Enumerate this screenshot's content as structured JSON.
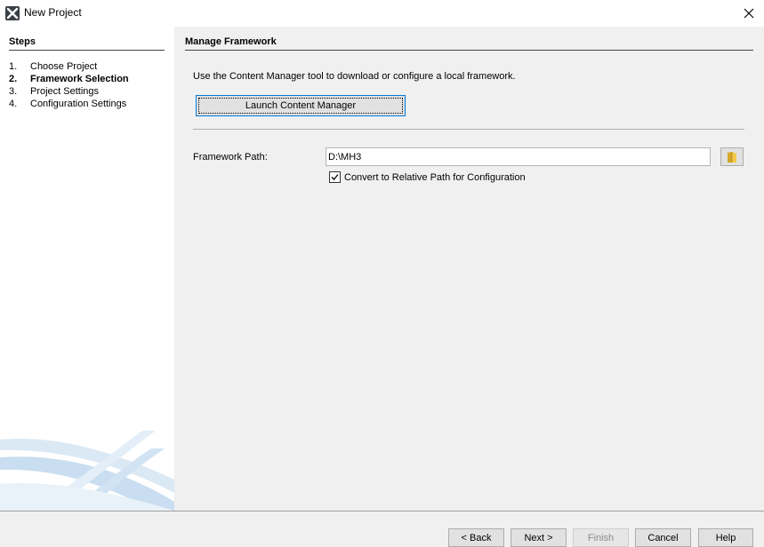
{
  "window": {
    "title": "New Project",
    "close_symbol": "✕"
  },
  "steps": {
    "heading": "Steps",
    "items": [
      {
        "num": "1.",
        "label": "Choose Project",
        "active": false
      },
      {
        "num": "2.",
        "label": "Framework Selection",
        "active": true
      },
      {
        "num": "3.",
        "label": "Project Settings",
        "active": false
      },
      {
        "num": "4.",
        "label": "Configuration Settings",
        "active": false
      }
    ]
  },
  "content": {
    "heading": "Manage Framework",
    "description": "Use the Content Manager tool to download or configure a local framework.",
    "launch_button": "Launch Content Manager",
    "framework_path_label": "Framework Path:",
    "framework_path_value": "D:\\MH3",
    "relative_path_checkbox": {
      "label": "Convert to Relative Path for Configuration",
      "checked": true
    }
  },
  "footer": {
    "back": "< Back",
    "next": "Next >",
    "finish": "Finish",
    "cancel": "Cancel",
    "help": "Help"
  },
  "icons": {
    "app": "app-logo-icon",
    "close": "close-icon",
    "browse": "folder-icon",
    "check": "checkmark-icon"
  },
  "colors": {
    "focus_border": "#0078d7",
    "panel_bg": "#f0f0f0",
    "button_bg": "#e1e1e1",
    "disabled_text": "#8c8c8c"
  }
}
